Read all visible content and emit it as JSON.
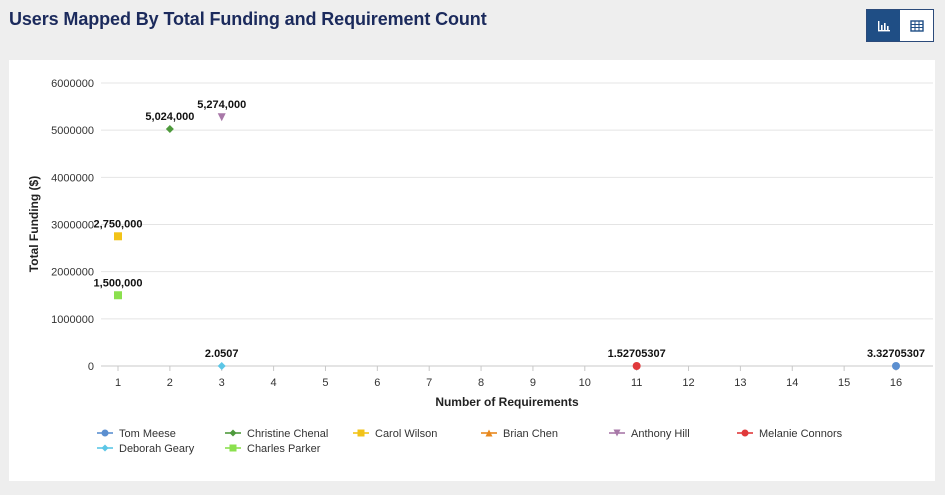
{
  "page": {
    "title": "Users Mapped By Total Funding and Requirement Count"
  },
  "toolbar": {
    "chart_view_icon": "bar-chart-icon",
    "table_view_icon": "table-grid-icon",
    "active_view": "chart"
  },
  "chart_data": {
    "type": "scatter",
    "title": "",
    "xlabel": "Number of Requirements",
    "ylabel": "Total Funding ($)",
    "xlim": [
      1,
      16
    ],
    "ylim": [
      0,
      6000000
    ],
    "x_ticks": [
      "1",
      "2",
      "3",
      "4",
      "5",
      "6",
      "7",
      "8",
      "9",
      "10",
      "11",
      "12",
      "13",
      "14",
      "15",
      "16"
    ],
    "y_ticks": [
      "0",
      "1000000",
      "2000000",
      "3000000",
      "4000000",
      "5000000",
      "6000000"
    ],
    "grid": "horizontal",
    "legend_position": "bottom-left",
    "series": [
      {
        "name": "Tom Meese",
        "color": "#5b8fd0",
        "marker": "circle",
        "points": [
          {
            "x": 16,
            "y": 3.32705307,
            "label": "3.32705307"
          }
        ]
      },
      {
        "name": "Christine Chenal",
        "color": "#4e9a3c",
        "marker": "diamond",
        "points": [
          {
            "x": 2,
            "y": 5024000,
            "label": "5,024,000"
          }
        ]
      },
      {
        "name": "Carol Wilson",
        "color": "#f2c318",
        "marker": "square",
        "points": [
          {
            "x": 1,
            "y": 2750000,
            "label": "2,750,000"
          }
        ]
      },
      {
        "name": "Brian Chen",
        "color": "#e8891e",
        "marker": "triangle",
        "points": []
      },
      {
        "name": "Anthony Hill",
        "color": "#a878a8",
        "marker": "triangle-down",
        "points": [
          {
            "x": 3,
            "y": 5274000,
            "label": "5,274,000"
          }
        ]
      },
      {
        "name": "Melanie Connors",
        "color": "#e0393b",
        "marker": "circle",
        "points": [
          {
            "x": 11,
            "y": 1.52705307,
            "label": "1.52705307"
          }
        ]
      },
      {
        "name": "Deborah Geary",
        "color": "#5cc6e6",
        "marker": "diamond",
        "points": [
          {
            "x": 3,
            "y": 2.0507,
            "label": "2.0507"
          }
        ]
      },
      {
        "name": "Charles Parker",
        "color": "#8be04e",
        "marker": "square",
        "points": [
          {
            "x": 1,
            "y": 1500000,
            "label": "1,500,000"
          }
        ]
      }
    ]
  }
}
